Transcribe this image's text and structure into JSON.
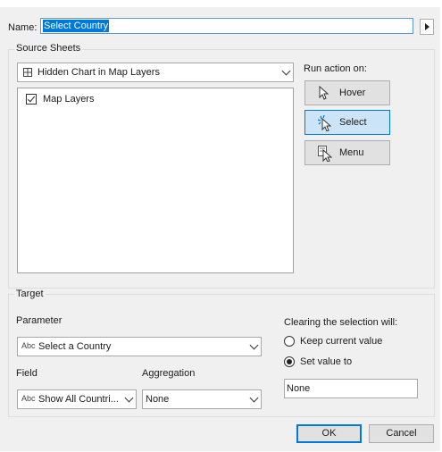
{
  "name_row": {
    "label": "Name:",
    "value": "Select Country"
  },
  "source_sheets": {
    "title": "Source Sheets",
    "dropdown_value": "Hidden Chart in Map Layers",
    "items": [
      {
        "label": "Map Layers",
        "checked": true
      }
    ]
  },
  "run_action": {
    "label": "Run action on:",
    "buttons": [
      {
        "label": "Hover",
        "active": false
      },
      {
        "label": "Select",
        "active": true
      },
      {
        "label": "Menu",
        "active": false
      }
    ]
  },
  "target": {
    "title": "Target",
    "parameter_label": "Parameter",
    "parameter_prefix": "Abc",
    "parameter_value": "Select a Country",
    "field_label": "Field",
    "field_prefix": "Abc",
    "field_value": "Show All Countri...",
    "aggregation_label": "Aggregation",
    "aggregation_value": "None",
    "clearing_label": "Clearing the selection will:",
    "options": [
      {
        "label": "Keep current value",
        "selected": false
      },
      {
        "label": "Set value to",
        "selected": true
      }
    ],
    "set_value": "None"
  },
  "footer": {
    "ok_label": "OK",
    "cancel_label": "Cancel"
  },
  "colors": {
    "accent": "#0078d7",
    "selected_bg": "#cce4f7",
    "dialog_bg": "#f0f0f0"
  }
}
